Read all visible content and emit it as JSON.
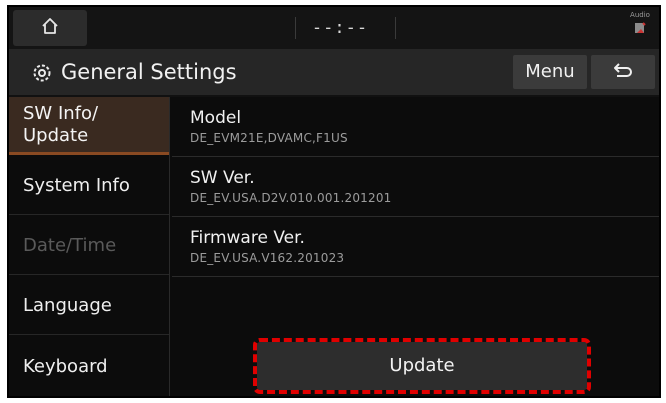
{
  "status_bar": {
    "home_icon": "home-icon",
    "clock": "--:--",
    "audio_label": "Audio",
    "audio_icon": "audio-icon"
  },
  "header": {
    "icon": "gear-icon",
    "title": "General Settings",
    "menu_label": "Menu",
    "back_icon": "back-icon"
  },
  "sidebar": {
    "items": [
      {
        "label": "SW Info/\nUpdate",
        "state": "selected"
      },
      {
        "label": "System Info",
        "state": "normal"
      },
      {
        "label": "Date/Time",
        "state": "disabled"
      },
      {
        "label": "Language",
        "state": "normal"
      },
      {
        "label": "Keyboard",
        "state": "normal"
      }
    ]
  },
  "info": {
    "rows": [
      {
        "label": "Model",
        "value": "DE_EVM21E,DVAMC,F1US"
      },
      {
        "label": "SW Ver.",
        "value": "DE_EV.USA.D2V.010.001.201201"
      },
      {
        "label": "Firmware Ver.",
        "value": "DE_EV.USA.V162.201023"
      }
    ]
  },
  "update_button": {
    "label": "Update",
    "highlight_color": "#e00000"
  },
  "colors": {
    "accent": "#8a4a22",
    "background": "#0c0c0c"
  }
}
